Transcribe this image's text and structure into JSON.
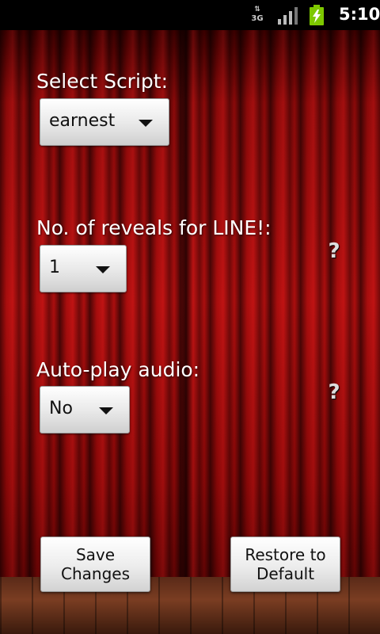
{
  "status_bar": {
    "network": "3G",
    "signal_icon": "signal-icon",
    "battery_icon": "battery-charging-icon",
    "time": "5:10"
  },
  "form": {
    "script": {
      "label": "Select Script:",
      "value": "earnest"
    },
    "reveals": {
      "label": "No. of reveals for LINE!:",
      "value": "1",
      "help": "?"
    },
    "autoplay": {
      "label": "Auto-play audio:",
      "value": "No",
      "help": "?"
    }
  },
  "buttons": {
    "save_line1": "Save",
    "save_line2": "Changes",
    "restore_line1": "Restore to",
    "restore_line2": "Default"
  },
  "colors": {
    "curtain": "#b10f0f",
    "floor": "#7a3d22"
  }
}
